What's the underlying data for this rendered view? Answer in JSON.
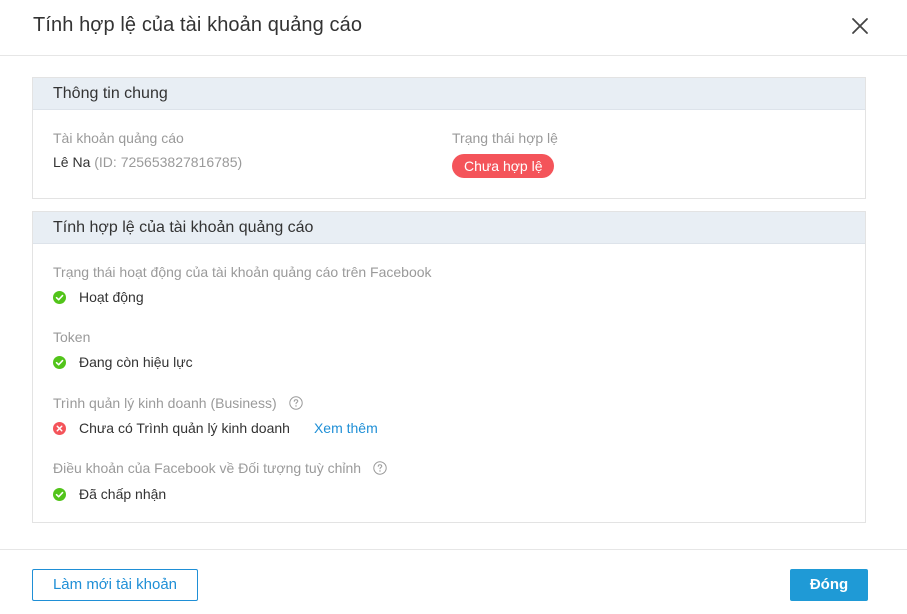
{
  "modal": {
    "title": "Tính hợp lệ của tài khoản quảng cáo",
    "close_icon": "close-icon"
  },
  "general_info": {
    "heading": "Thông tin chung",
    "ad_account_label": "Tài khoản quảng cáo",
    "account_name": "Lê Na",
    "account_id": "(ID: 725653827816785)",
    "validity_label": "Trạng thái hợp lệ",
    "validity_badge": "Chưa hợp lệ",
    "badge_color": "#f4545a"
  },
  "validity": {
    "heading": "Tính hợp lệ của tài khoản quảng cáo",
    "items": [
      {
        "label": "Trạng thái hoạt động của tài khoản quảng cáo trên Facebook",
        "status": "ok",
        "value": "Hoạt động"
      },
      {
        "label": "Token",
        "status": "ok",
        "value": "Đang còn hiệu lực"
      },
      {
        "label": "Trình quản lý kinh doanh (Business)",
        "status": "error",
        "value": "Chưa có Trình quản lý kinh doanh",
        "link": "Xem thêm",
        "help": true
      },
      {
        "label": "Điều khoản của Facebook về Đối tượng tuỳ chỉnh",
        "status": "ok",
        "value": "Đã chấp nhận",
        "help": true
      }
    ],
    "ok_color": "#52c41a",
    "error_color": "#f4545a"
  },
  "footer": {
    "refresh_label": "Làm mới tài khoản",
    "close_label": "Đóng",
    "accent": "#1f8fd6"
  }
}
